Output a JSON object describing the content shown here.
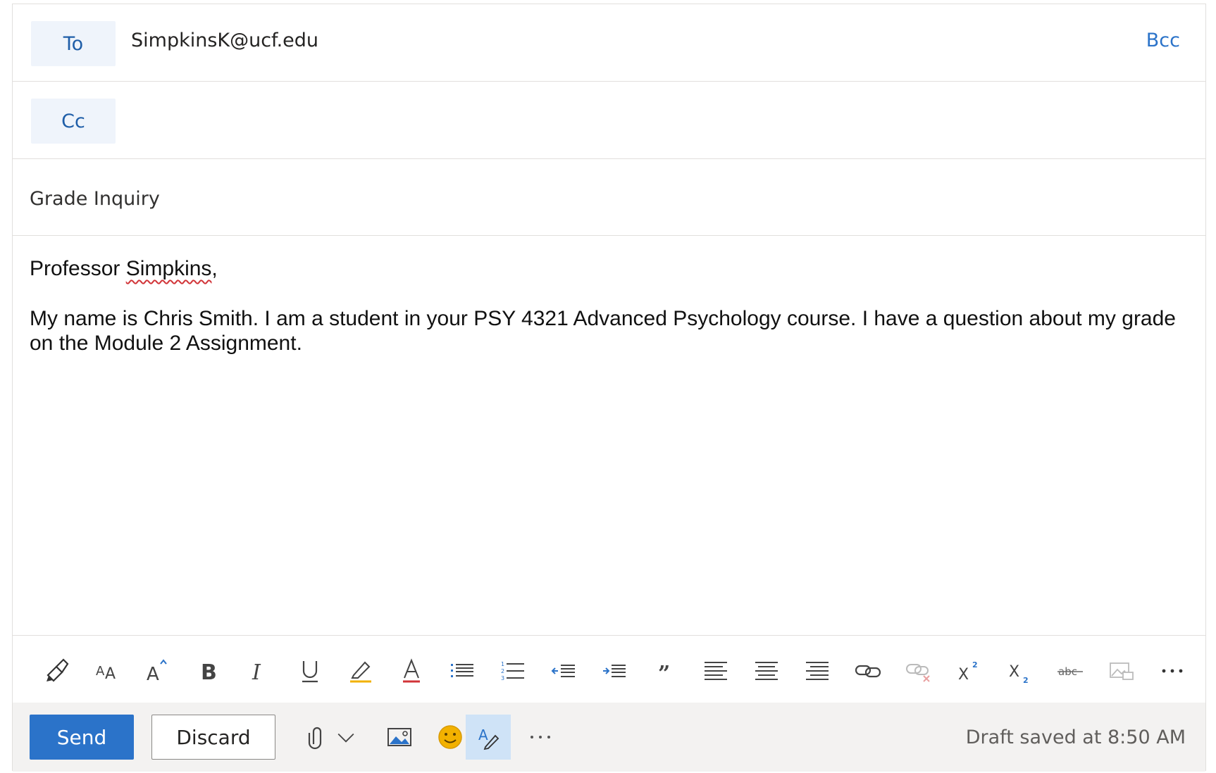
{
  "recipients": {
    "to_label": "To",
    "to_value": "SimpkinsK@ucf.edu",
    "cc_label": "Cc",
    "bcc_label": "Bcc"
  },
  "subject": {
    "value": "Grade Inquiry"
  },
  "body": {
    "greeting_prefix": "Professor ",
    "greeting_name": "Simpkins",
    "greeting_suffix": ",",
    "paragraph": "My name is Chris Smith. I am a student in your PSY 4321 Advanced Psychology course. I have a question about my grade on the Module 2 Assignment."
  },
  "toolbar": {
    "icons": [
      "format-painter-icon",
      "font-size-icon",
      "grow-font-icon",
      "bold-icon",
      "italic-icon",
      "underline-icon",
      "highlight-icon",
      "font-color-icon",
      "bullets-icon",
      "numbering-icon",
      "decrease-indent-icon",
      "increase-indent-icon",
      "quote-icon",
      "align-left-icon",
      "align-center-icon",
      "align-right-icon",
      "insert-link-icon",
      "remove-link-icon",
      "superscript-icon",
      "subscript-icon",
      "strikethrough-icon",
      "inline-picture-icon",
      "more-options-icon"
    ]
  },
  "footer": {
    "send_label": "Send",
    "discard_label": "Discard",
    "draft_status": "Draft saved at 8:50 AM"
  },
  "colors": {
    "accent": "#2b73c9",
    "pill_bg": "#eff4fb",
    "footer_bg": "#f3f2f1",
    "highlight": "#f2b100",
    "font_color": "#d13438",
    "emoji": "#f2b100"
  }
}
